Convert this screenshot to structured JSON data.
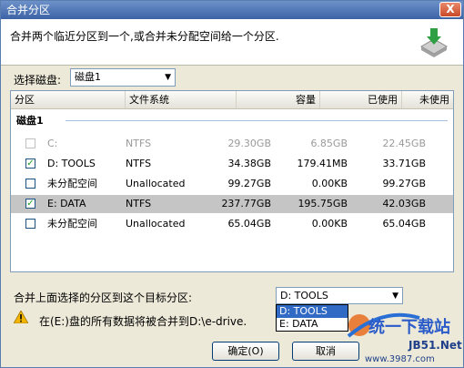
{
  "window": {
    "title": "合并分区",
    "close_label": "X"
  },
  "header": {
    "instruction": "合并两个临近分区到一个,或合并未分配空间给一个分区.",
    "icon": "merge-disk-icon"
  },
  "disk_select": {
    "label": "选择磁盘:",
    "value": "磁盘1"
  },
  "table": {
    "columns": [
      "分区",
      "文件系统",
      "容量",
      "已使用",
      "未使用"
    ],
    "group_label": "磁盘1",
    "rows": [
      {
        "name": "C:",
        "fs": "NTFS",
        "capacity": "29.30GB",
        "used": "6.85GB",
        "free": "22.45GB",
        "checked": "",
        "disabled": true
      },
      {
        "name": "D:  TOOLS",
        "fs": "NTFS",
        "capacity": "34.38GB",
        "used": "179.41MB",
        "free": "33.71GB",
        "checked": "✓",
        "disabled": false
      },
      {
        "name": "未分配空间",
        "fs": "Unallocated",
        "capacity": "99.27GB",
        "used": "0.00KB",
        "free": "99.27GB",
        "checked": "",
        "disabled": false
      },
      {
        "name": "E:  DATA",
        "fs": "NTFS",
        "capacity": "237.77GB",
        "used": "195.75GB",
        "free": "42.03GB",
        "checked": "✓",
        "disabled": false
      },
      {
        "name": "未分配空间",
        "fs": "Unallocated",
        "capacity": "65.04GB",
        "used": "0.00KB",
        "free": "65.04GB",
        "checked": "",
        "disabled": false
      }
    ]
  },
  "target": {
    "label": "合并上面选择的分区到这个目标分区:",
    "value": "D:  TOOLS",
    "options": [
      "D:  TOOLS",
      "E:  DATA"
    ]
  },
  "warning": {
    "text": "在(E:)盘的所有数据将被合并到D:\\e-drive."
  },
  "buttons": {
    "ok": "确定(O)",
    "cancel": "取消"
  },
  "watermark": {
    "brand": "统一下载站",
    "site": "JB51.Net",
    "url": "www.3987.com"
  },
  "colors": {
    "title_bar": "#3c63a6",
    "selection": "#c5c5c5",
    "highlight": "#316ac5",
    "check": "#21a121"
  }
}
